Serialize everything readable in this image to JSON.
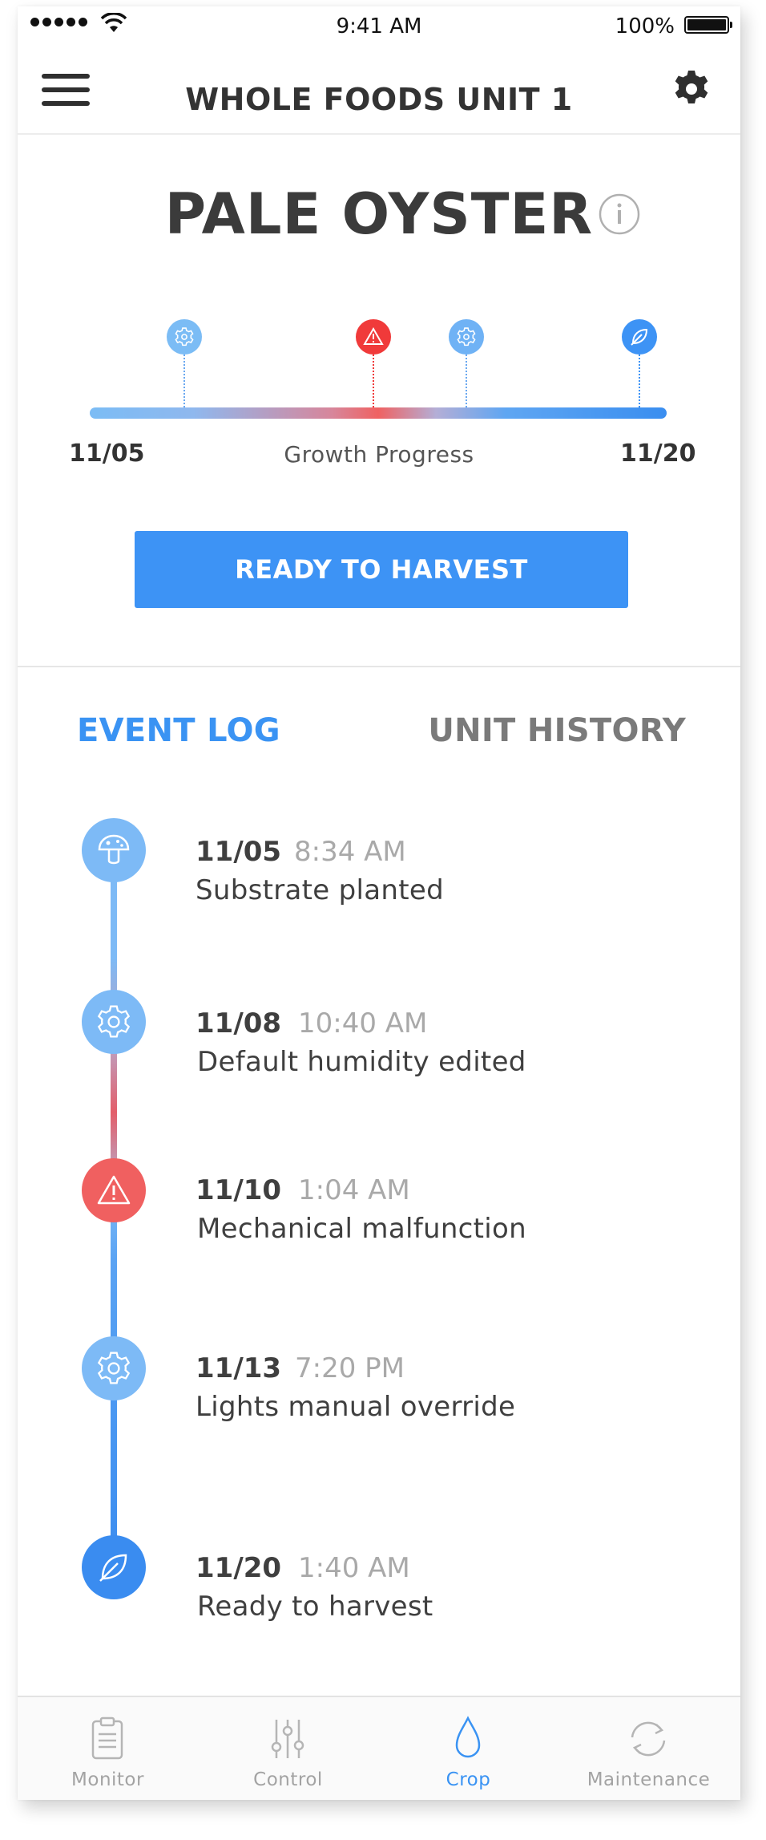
{
  "status_bar": {
    "time": "9:41 AM",
    "battery": "100%"
  },
  "header": {
    "title": "WHOLE FOODS UNIT 1"
  },
  "crop": {
    "name": "PALE OYSTER"
  },
  "progress": {
    "start_label": "11/05",
    "label": "Growth Progress",
    "end_label": "11/20",
    "markers": [
      {
        "icon": "gear-icon",
        "color": "#7bbcf5"
      },
      {
        "icon": "warning-icon",
        "color": "#f03a3a"
      },
      {
        "icon": "gear-icon",
        "color": "#6fb2f5"
      },
      {
        "icon": "leaf-icon",
        "color": "#3d93f5"
      }
    ]
  },
  "harvest_button": {
    "label": "READY TO HARVEST"
  },
  "tabs": {
    "event_log": "EVENT LOG",
    "unit_history": "UNIT HISTORY",
    "active": "event_log"
  },
  "events": [
    {
      "date": "11/05",
      "time": "8:34 AM",
      "description": "Substrate planted",
      "icon": "mushroom-icon",
      "color": "#7dbaf6"
    },
    {
      "date": "11/08",
      "time": "10:40 AM",
      "description": "Default humidity edited",
      "icon": "gear-icon",
      "color": "#7dbaf6"
    },
    {
      "date": "11/10",
      "time": "1:04 AM",
      "description": "Mechanical malfunction",
      "icon": "warning-icon",
      "color": "#f06060"
    },
    {
      "date": "11/13",
      "time": "7:20 PM",
      "description": "Lights manual override",
      "icon": "gear-icon",
      "color": "#7dbaf6"
    },
    {
      "date": "11/20",
      "time": "1:40 AM",
      "description": "Ready to harvest",
      "icon": "leaf-icon",
      "color": "#3a8cf0"
    }
  ],
  "tab_bar": {
    "items": [
      {
        "label": "Monitor",
        "icon": "clipboard-icon",
        "active": false
      },
      {
        "label": "Control",
        "icon": "sliders-icon",
        "active": false
      },
      {
        "label": "Crop",
        "icon": "droplet-icon",
        "active": true
      },
      {
        "label": "Maintenance",
        "icon": "refresh-icon",
        "active": false
      }
    ]
  },
  "colors": {
    "accent": "#3d93f5",
    "alert": "#f03a3a",
    "muted": "#a9a9a9"
  }
}
